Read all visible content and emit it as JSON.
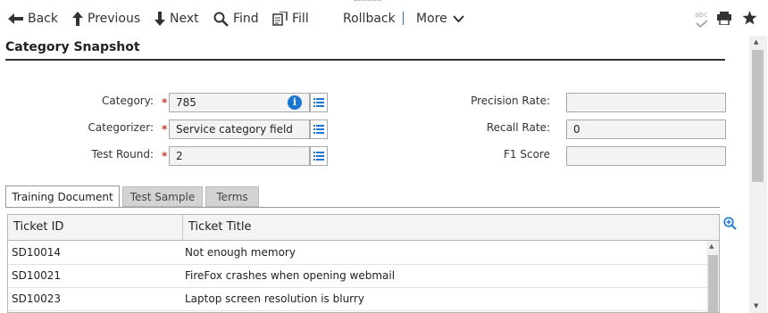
{
  "toolbar": {
    "back": "Back",
    "previous": "Previous",
    "next": "Next",
    "find": "Find",
    "fill": "Fill",
    "rollback": "Rollback",
    "more": "More",
    "spell_label": "abc"
  },
  "page": {
    "title": "Category Snapshot"
  },
  "form": {
    "category": {
      "label": "Category:",
      "value": "785"
    },
    "categorizer": {
      "label": "Categorizer:",
      "value": "Service category field"
    },
    "test_round": {
      "label": "Test Round:",
      "value": "2"
    },
    "precision_rate": {
      "label": "Precision Rate:",
      "value": ""
    },
    "recall_rate": {
      "label": "Recall Rate:",
      "value": "0"
    },
    "f1_score": {
      "label": "F1 Score",
      "value": ""
    },
    "required_mark": "*"
  },
  "tabs": [
    {
      "label": "Training Document",
      "active": true
    },
    {
      "label": "Test Sample",
      "active": false
    },
    {
      "label": "Terms",
      "active": false
    }
  ],
  "table": {
    "columns": [
      "Ticket ID",
      "Ticket Title"
    ],
    "rows": [
      {
        "id": "SD10014",
        "title": "Not enough memory"
      },
      {
        "id": "SD10021",
        "title": "FireFox crashes when opening webmail"
      },
      {
        "id": "SD10023",
        "title": "Laptop screen resolution is blurry"
      }
    ]
  },
  "colors": {
    "accent": "#1976d2",
    "required": "#c0392b"
  }
}
